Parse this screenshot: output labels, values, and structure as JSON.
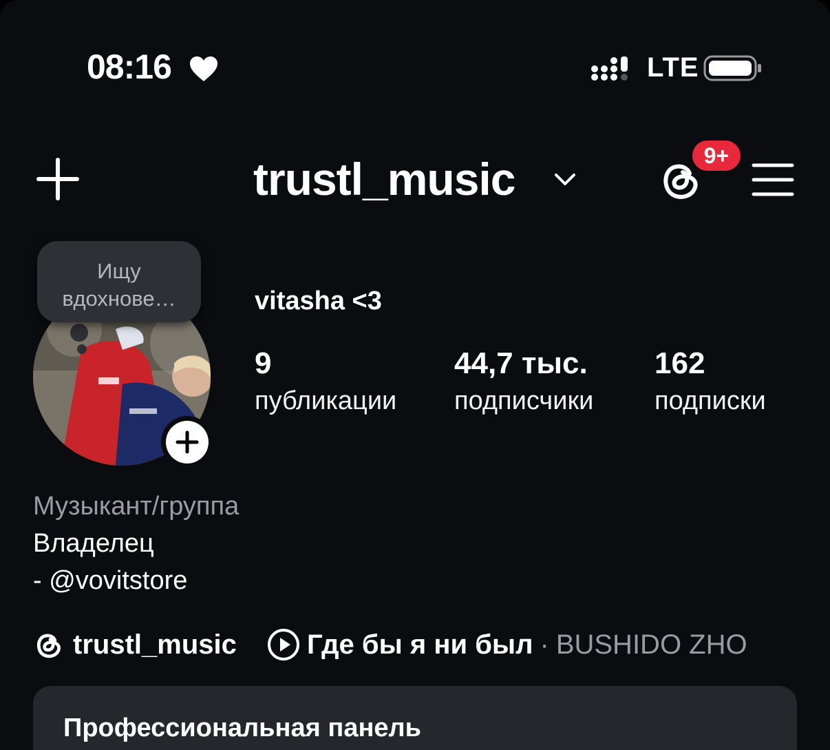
{
  "status_bar": {
    "time": "08:16",
    "network": "LTE",
    "heart_icon": "heart-icon",
    "signal_icon": "cellular-signal-icon",
    "battery_icon": "battery-icon"
  },
  "header": {
    "username": "trustl_music",
    "notification_badge": "9+",
    "icons": [
      "plus-icon",
      "chevron-down-icon",
      "threads-icon",
      "menu-icon"
    ]
  },
  "profile": {
    "note": "Ищу\nвдохнове…",
    "display_name": "vitasha <3",
    "stats": [
      {
        "value": "9",
        "label": "публикации"
      },
      {
        "value": "44,7 тыс.",
        "label": "подписчики"
      },
      {
        "value": "162",
        "label": "подписки"
      }
    ],
    "category": "Музыкант/группа",
    "bio_lines": [
      "Владелец",
      "- @vovitstore"
    ]
  },
  "links": {
    "threads_handle": "trustl_music",
    "song_title": "Где бы я ни был",
    "separator": "·",
    "artist": "BUSHIDO ZHO"
  },
  "pro_panel": {
    "title": "Профессиональная панель"
  },
  "colors": {
    "background": "#0b0c10",
    "badge": "#e8283b",
    "muted_text": "#9a9ca3",
    "panel": "#26272c"
  }
}
